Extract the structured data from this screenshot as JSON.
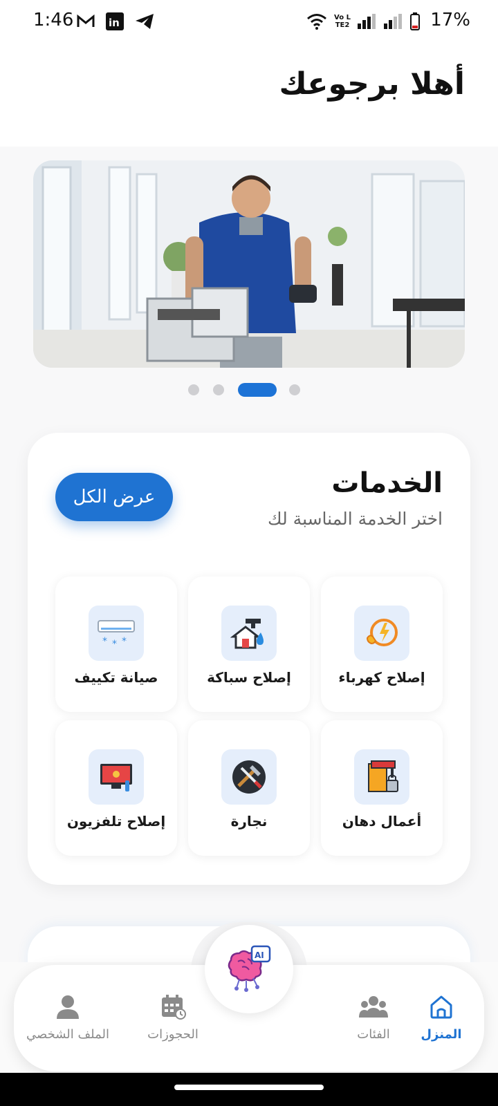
{
  "status_bar": {
    "time": "1:46",
    "notification_icons": [
      "gmail-icon",
      "linkedin-icon",
      "telegram-icon"
    ],
    "system_icons": [
      "wifi-icon",
      "volte-icon",
      "signal-icon",
      "signal-icon",
      "battery-icon"
    ],
    "battery_percent": "17%",
    "lte_label": "Vo LTE2"
  },
  "header": {
    "greeting": "أهلا برجوعك"
  },
  "banner": {
    "image": "technician-with-toolbox-photo",
    "page_count": 4,
    "active_page": 3
  },
  "services": {
    "title": "الخدمات",
    "subtitle": "اختر الخدمة المناسبة لك",
    "view_all_label": "عرض الكل",
    "items": [
      {
        "label": "إصلاح كهرباء",
        "icon": "electric-repair-icon"
      },
      {
        "label": "إصلاح سباكة",
        "icon": "plumbing-repair-icon"
      },
      {
        "label": "صيانة تكييف",
        "icon": "ac-maintenance-icon"
      },
      {
        "label": "أعمال دهان",
        "icon": "painting-icon"
      },
      {
        "label": "نجارة",
        "icon": "carpentry-icon"
      },
      {
        "label": "إصلاح تلفزيون",
        "icon": "tv-repair-icon"
      }
    ]
  },
  "bottom_nav": {
    "items": [
      {
        "label": "المنزل",
        "icon": "home-icon",
        "active": true
      },
      {
        "label": "الفئات",
        "icon": "categories-icon",
        "active": false
      },
      {
        "label": "الحجوزات",
        "icon": "calendar-icon",
        "active": false
      },
      {
        "label": "الملف الشخصي",
        "icon": "profile-icon",
        "active": false
      }
    ],
    "center_button": {
      "icon": "ai-brain-icon",
      "badge": "AI"
    }
  },
  "colors": {
    "accent": "#1f73d2",
    "tile_icon_bg": "#e5eefb",
    "inactive_nav": "#8a8a8a"
  }
}
